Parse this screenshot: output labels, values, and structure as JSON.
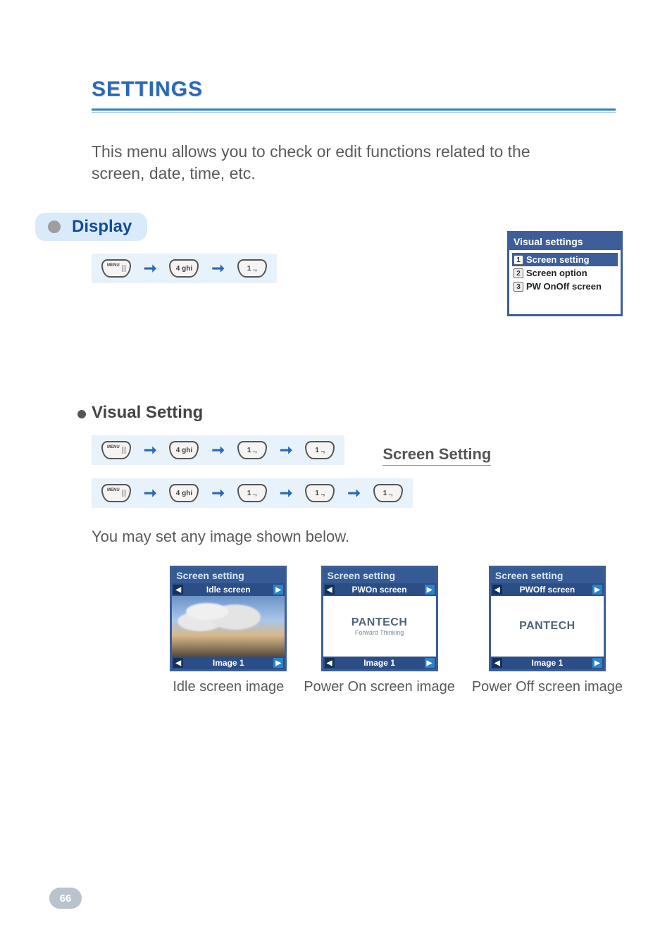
{
  "page_number": "66",
  "title": "SETTINGS",
  "intro": "This menu allows you to check or edit functions related to the screen, date, time, etc.",
  "section_display": {
    "heading": "Display"
  },
  "keyseq_display": [
    "MENU",
    "4 ghi",
    "1 .,"
  ],
  "phone_visual_settings": {
    "title": "Visual settings",
    "items": [
      {
        "num": "1",
        "label": "Screen setting",
        "selected": true
      },
      {
        "num": "2",
        "label": "Screen option",
        "selected": false
      },
      {
        "num": "3",
        "label": "PW OnOff screen",
        "selected": false
      }
    ]
  },
  "section_visual_setting": {
    "heading": "Visual Setting"
  },
  "keyseq_visual": [
    "MENU",
    "4 ghi",
    "1 .,",
    "1 .,"
  ],
  "subsection_screen_setting": {
    "heading": "Screen Setting"
  },
  "keyseq_screen_setting": [
    "MENU",
    "4 ghi",
    "1 .,",
    "1 .,",
    "1 .,"
  ],
  "body_text": "You may set any image shown below.",
  "tiles": [
    {
      "title": "Screen setting",
      "tab": "Idle screen",
      "footer": "Image 1",
      "caption": "Idle screen image",
      "body_type": "clouds"
    },
    {
      "title": "Screen setting",
      "tab": "PWOn screen",
      "footer": "Image 1",
      "caption": "Power On screen image",
      "body_type": "pantech_sub",
      "brand": "PANTECH",
      "brand_sub": "Forward Thinking"
    },
    {
      "title": "Screen setting",
      "tab": "PWOff screen",
      "footer": "Image 1",
      "caption": "Power Off screen image",
      "body_type": "pantech",
      "brand": "PANTECH"
    }
  ]
}
